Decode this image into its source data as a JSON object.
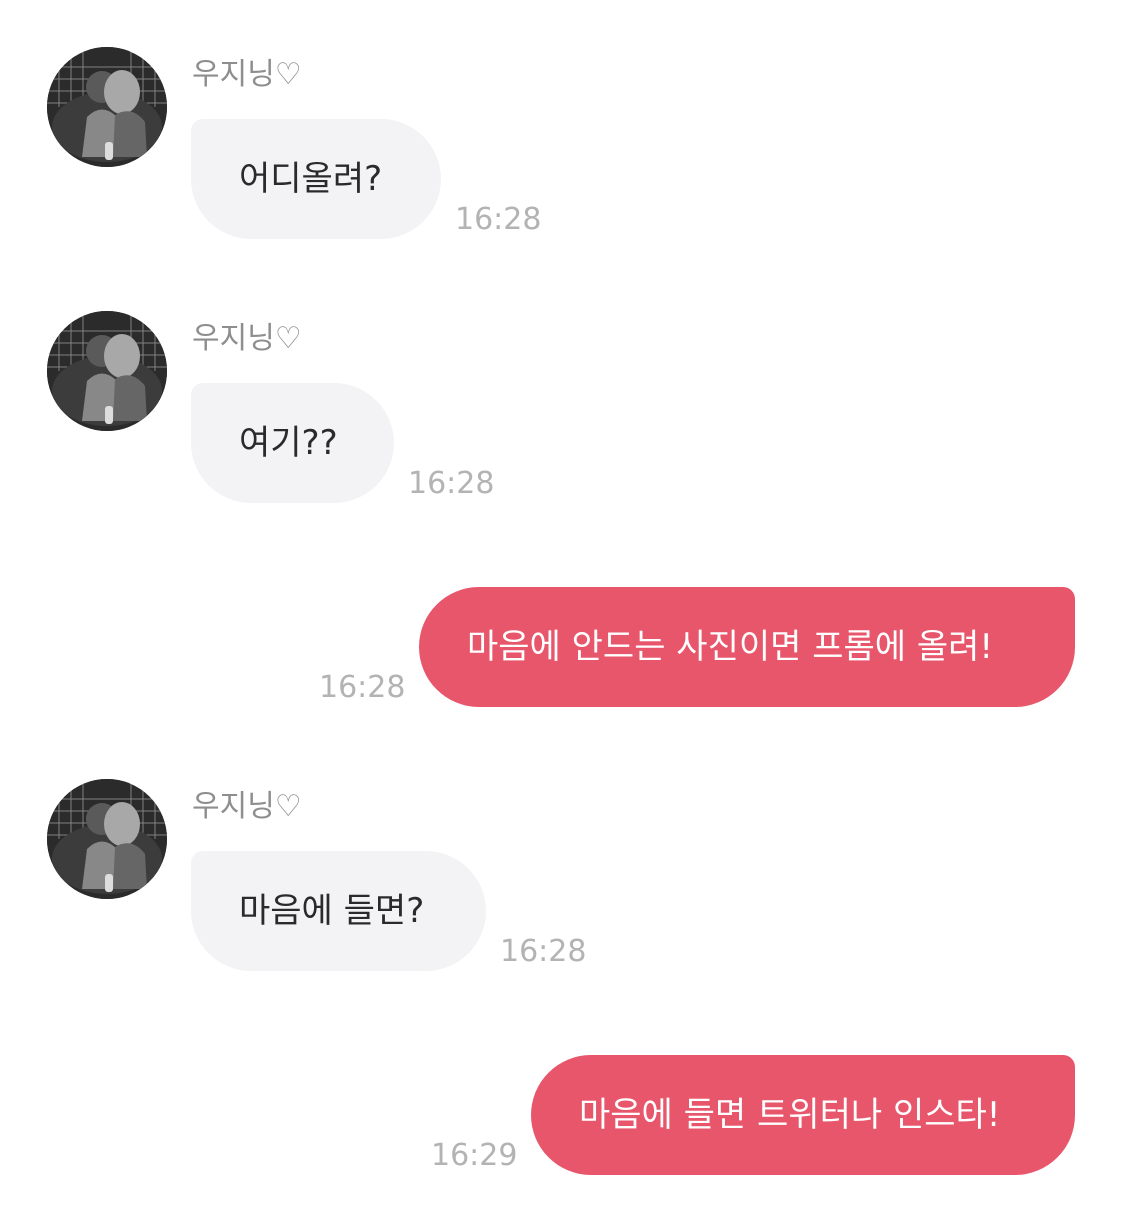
{
  "colors": {
    "incoming_bubble": "#f3f3f5",
    "outgoing_bubble": "#e8566b",
    "timestamp": "#b3b3b3",
    "sender_name": "#8e8e8e"
  },
  "messages": [
    {
      "direction": "incoming",
      "sender": "우지닝♡",
      "text": "어디올려?",
      "time": "16:28",
      "avatar": "profile-photo"
    },
    {
      "direction": "incoming",
      "sender": "우지닝♡",
      "text": "여기??",
      "time": "16:28",
      "avatar": "profile-photo"
    },
    {
      "direction": "outgoing",
      "text": "마음에 안드는 사진이면 프롬에 올려!",
      "time": "16:28"
    },
    {
      "direction": "incoming",
      "sender": "우지닝♡",
      "text": "마음에 들면?",
      "time": "16:28",
      "avatar": "profile-photo"
    },
    {
      "direction": "outgoing",
      "text": "마음에 들면 트위터나 인스타!",
      "time": "16:29"
    }
  ]
}
